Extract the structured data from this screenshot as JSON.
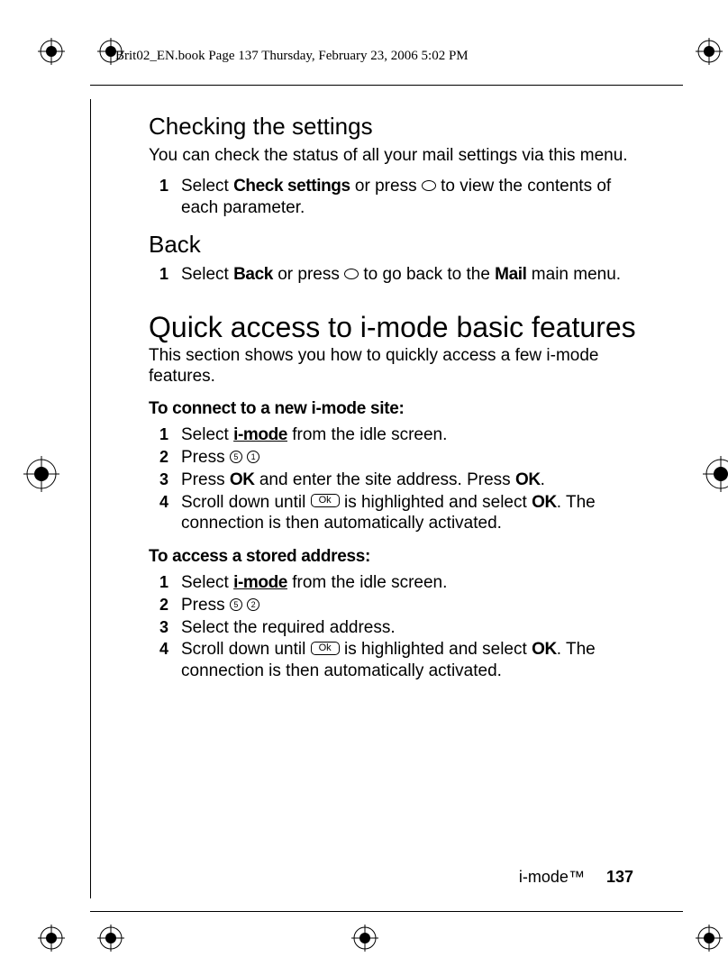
{
  "header": {
    "running": "Brit02_EN.book  Page 137  Thursday, February 23, 2006  5:02 PM"
  },
  "s1": {
    "title": "Checking the settings",
    "intro": "You can check the status of all your mail settings via this menu.",
    "step1_a": "Select ",
    "step1_bold": "Check settings",
    "step1_b": " or press ",
    "step1_c": " to view the contents of each parameter."
  },
  "s2": {
    "title": "Back",
    "step1_a": "Select ",
    "step1_bold": "Back",
    "step1_b": " or press ",
    "step1_c": " to go back to the ",
    "step1_bold2": "Mail",
    "step1_d": " main menu."
  },
  "s3": {
    "title": "Quick access to i-mode basic features",
    "intro": "This section shows you how to quickly access a few i-mode features."
  },
  "s4": {
    "title": "To connect to a new i-mode site:",
    "step1_a": "Select ",
    "step1_u": "i-mode",
    "step1_b": " from the idle screen.",
    "step2_a": "Press ",
    "step3_a": "Press ",
    "step3_ok1": "OK",
    "step3_b": " and enter the site address. Press ",
    "step3_ok2": "OK",
    "step3_c": ".",
    "step4_a": "Scroll down until ",
    "step4_chip": "Ok",
    "step4_b": " is highlighted and select ",
    "step4_ok": "OK",
    "step4_c": ". The connection is then automatically activated."
  },
  "s5": {
    "title": "To access a stored address:",
    "step1_a": "Select ",
    "step1_u": "i-mode",
    "step1_b": " from the idle screen.",
    "step2_a": "Press ",
    "step3": "Select the required address.",
    "step4_a": "Scroll down until ",
    "step4_chip": "Ok",
    "step4_b": " is highlighted and select ",
    "step4_ok": "OK",
    "step4_c": ". The connection is then automatically activated."
  },
  "footer": {
    "section": "i-mode™",
    "page": "137"
  },
  "nums": {
    "n1": "1",
    "n2": "2",
    "n3": "3",
    "n4": "4"
  },
  "keys": {
    "k5": "5",
    "k1": "1",
    "k2": "2"
  }
}
